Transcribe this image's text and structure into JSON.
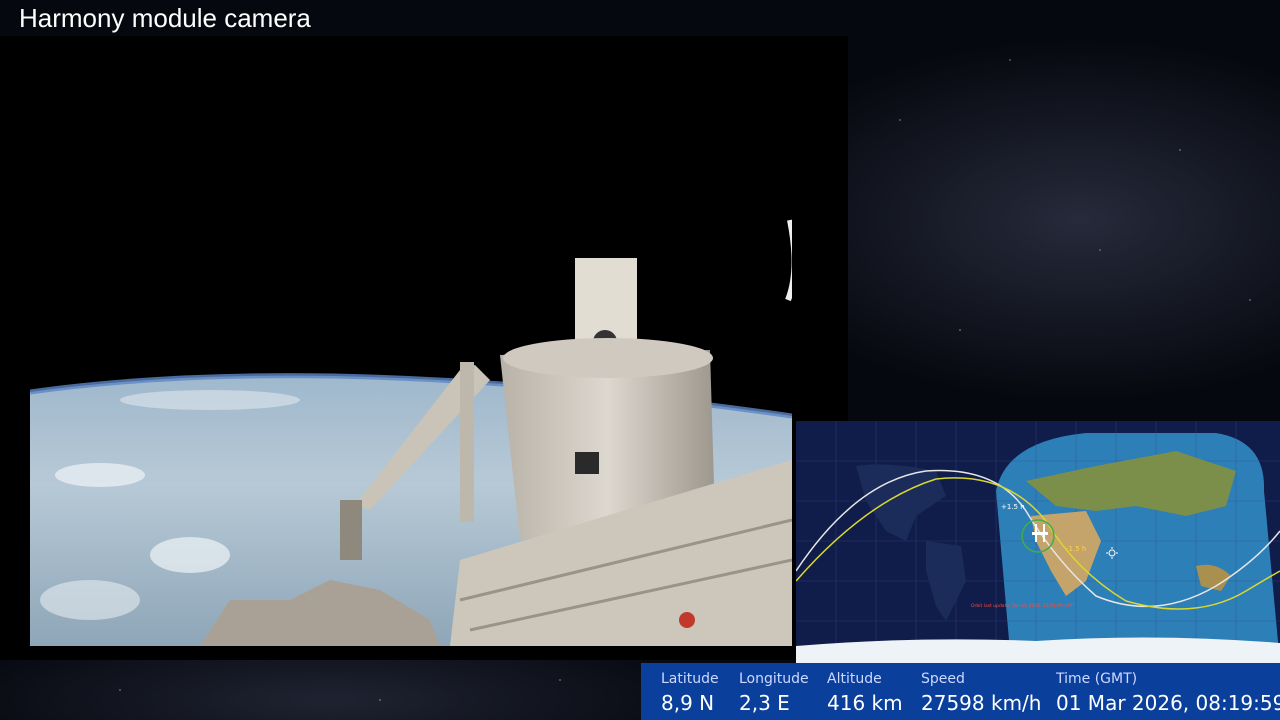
{
  "title": "Harmony module camera",
  "telemetry": {
    "latitude": {
      "label": "Latitude",
      "value": "8,9 N"
    },
    "longitude": {
      "label": "Longitude",
      "value": "2,3 E"
    },
    "altitude": {
      "label": "Altitude",
      "value": "416 km"
    },
    "speed": {
      "label": "Speed",
      "value": "27598 km/h"
    },
    "time": {
      "label": "Time (GMT)",
      "value": "01 Mar 2026, 08:19:59"
    }
  },
  "map": {
    "orbit_markers": [
      "+1.5 h",
      "-1.5 h"
    ],
    "footer_note": "Orbit last update: 28 Feb 2026, 13:01:09 GMT",
    "colors": {
      "day": "#2d7fb8",
      "night": "#0f1b48",
      "orbit_past": "#e6e6e6",
      "orbit_future": "#d8d830"
    }
  },
  "icons": [
    "iss-icon",
    "sun-icon"
  ]
}
